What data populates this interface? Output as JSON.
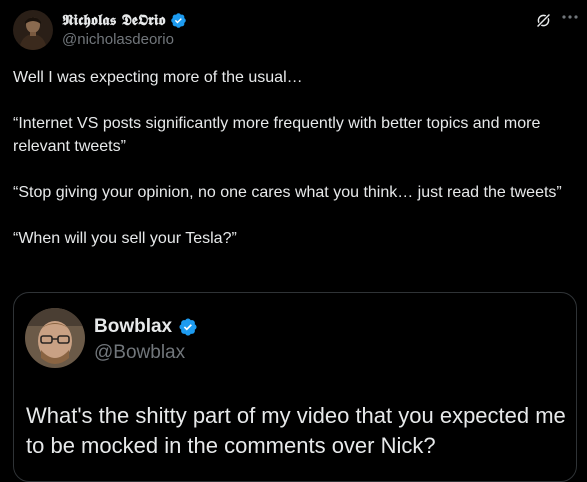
{
  "author": {
    "display_name": "𝕹𝖎𝖈𝖍𝖔𝖑𝖆𝖘 𝕯𝖊𝕺𝖗𝖎𝖔",
    "handle": "@nicholasdeorio",
    "verified": true,
    "avatar_icon": "portrait-avatar"
  },
  "actions": {
    "grok_icon": "grok-icon",
    "more_icon": "more-horizontal-icon"
  },
  "tweet": {
    "paragraphs": [
      "Well I was expecting more of the usual…",
      "“Internet VS posts significantly more frequently with better topics and more relevant tweets”",
      "“Stop giving your opinion, no one cares what you think… just read the tweets”",
      "“When will you sell your Tesla?”"
    ]
  },
  "quote": {
    "display_name": "Bowblax",
    "handle": "@Bowblax",
    "verified": true,
    "text": "What's the shitty part of my video that you expected me to be mocked in the comments over Nick?"
  },
  "colors": {
    "background": "#000000",
    "text_primary": "#e7e9ea",
    "text_secondary": "#71767b",
    "verified_blue": "#1d9bf0",
    "border": "#2f3336"
  }
}
